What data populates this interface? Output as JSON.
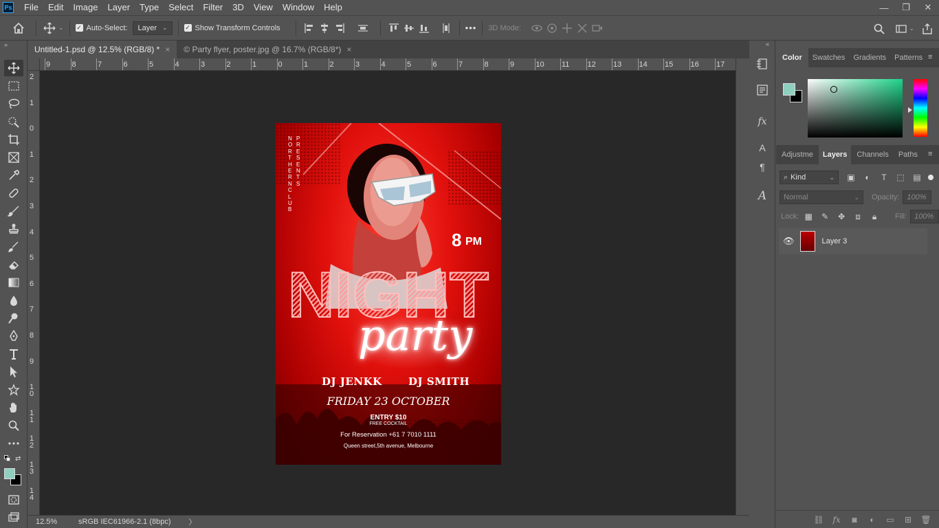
{
  "app": {
    "logo": "Ps"
  },
  "menu": [
    "File",
    "Edit",
    "Image",
    "Layer",
    "Type",
    "Select",
    "Filter",
    "3D",
    "View",
    "Window",
    "Help"
  ],
  "window_controls": {
    "minimize": "—",
    "maximize": "❐",
    "close": "✕"
  },
  "options_bar": {
    "auto_select_label": "Auto-Select:",
    "auto_select_value": "Layer",
    "show_transform_label": "Show Transform Controls",
    "more": "•••",
    "mode_3d_label": "3D Mode:"
  },
  "tabs": [
    {
      "title": "Untitled-1.psd @ 12.5% (RGB/8) *",
      "close": "×"
    },
    {
      "title": "© Party flyer, poster.jpg @ 16.7% (RGB/8*)",
      "close": "×"
    }
  ],
  "ruler_top_labels": [
    "9",
    "8",
    "7",
    "6",
    "5",
    "4",
    "3",
    "2",
    "1",
    "0",
    "1",
    "2",
    "3",
    "4",
    "5",
    "6",
    "7",
    "8",
    "9",
    "10",
    "11",
    "12",
    "13",
    "14",
    "15",
    "16",
    "17"
  ],
  "ruler_left_labels": [
    "2",
    "1",
    "0",
    "1",
    "2",
    "3",
    "4",
    "5",
    "6",
    "7",
    "8",
    "9",
    "1\n0",
    "1\n1",
    "1\n2",
    "1\n3",
    "1\n4"
  ],
  "flyer": {
    "vertical_left": "NORTHERN CLUB",
    "vertical_right": "PRESENTS",
    "time": "8",
    "time_suffix": "PM",
    "headline": "NIGHT",
    "script": "party",
    "dj_one": "DJ JENKK",
    "dj_two": "DJ SMITH",
    "date": "FRIDAY 23 OCTOBER",
    "entry": "ENTRY $10",
    "entry_sub": "FREE COCKTAIL",
    "reservation": "For Reservation +61 7 7010 1111",
    "address": "Queen street,5th avenue, Melbourne"
  },
  "status_bar": {
    "zoom": "12.5%",
    "profile": "sRGB IEC61966-2.1 (8bpc)",
    "arrow": "〉"
  },
  "color_panel": {
    "tabs": [
      "Color",
      "Swatches",
      "Gradients",
      "Patterns"
    ],
    "foreground": "#8fcfc0",
    "background": "#000000"
  },
  "layers_panel": {
    "tabs": [
      "Adjustme",
      "Layers",
      "Channels",
      "Paths"
    ],
    "filter_kind": "Kind",
    "blend_mode": "Normal",
    "opacity_label": "Opacity:",
    "opacity_value": "100%",
    "lock_label": "Lock:",
    "fill_label": "Fill:",
    "fill_value": "100%",
    "layers": [
      {
        "name": "Layer 3",
        "visible": true
      }
    ]
  }
}
